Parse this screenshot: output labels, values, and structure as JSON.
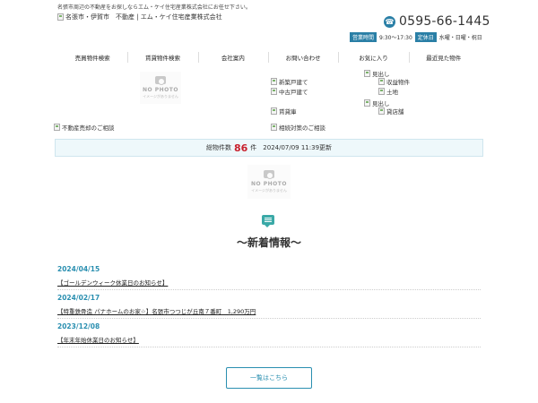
{
  "header": {
    "tagline": "名張市周辺の不動産をお探しならエム・ケイ住宅産業株式会社にお任せ下さい。",
    "logo_alt": "名張市・伊賀市　不動産 | エム・ケイ住宅産業株式会社",
    "phone": "0595-66-1445",
    "hours_label": "営業時間",
    "hours": "9:30～17:30",
    "closed_label": "定休日",
    "closed_days": "水曜・日曜・祝日"
  },
  "nav": [
    {
      "label": "売買物件検索"
    },
    {
      "label": "賃貸物件検索"
    },
    {
      "label": "会社案内"
    },
    {
      "label": "お問い合わせ"
    },
    {
      "label": "お気に入り"
    },
    {
      "label": "最近見た物件"
    }
  ],
  "nophoto": {
    "title": "NO PHOTO",
    "subtitle": "イメージがありません"
  },
  "links": {
    "new_house": "新築戸建て",
    "used_house": "中古戸建て",
    "rental": "賃貸庫",
    "midashi1": "見出し",
    "income": "収益物件",
    "land": "土地",
    "midashi2": "見出し",
    "shop": "貸店舗",
    "sell_consult": "不動産売却のご相談",
    "inherit_consult": "相続対策のご相談"
  },
  "count": {
    "label": "総物件数",
    "value": "86",
    "unit": "件",
    "updated": "2024/07/09 11:39更新"
  },
  "news": {
    "title": "～新着情報～",
    "items": [
      {
        "date": "2024/04/15",
        "text": "【ゴールデンウィーク休業日のお知らせ】"
      },
      {
        "date": "2024/02/17",
        "text": "【特重鉄骨造 パナホームのお家☆】名張市つつじが丘南７番町　1,290万円"
      },
      {
        "date": "2023/12/08",
        "text": "【年末年始休業日のお知らせ】"
      }
    ],
    "more_label": "一覧はこちら"
  }
}
